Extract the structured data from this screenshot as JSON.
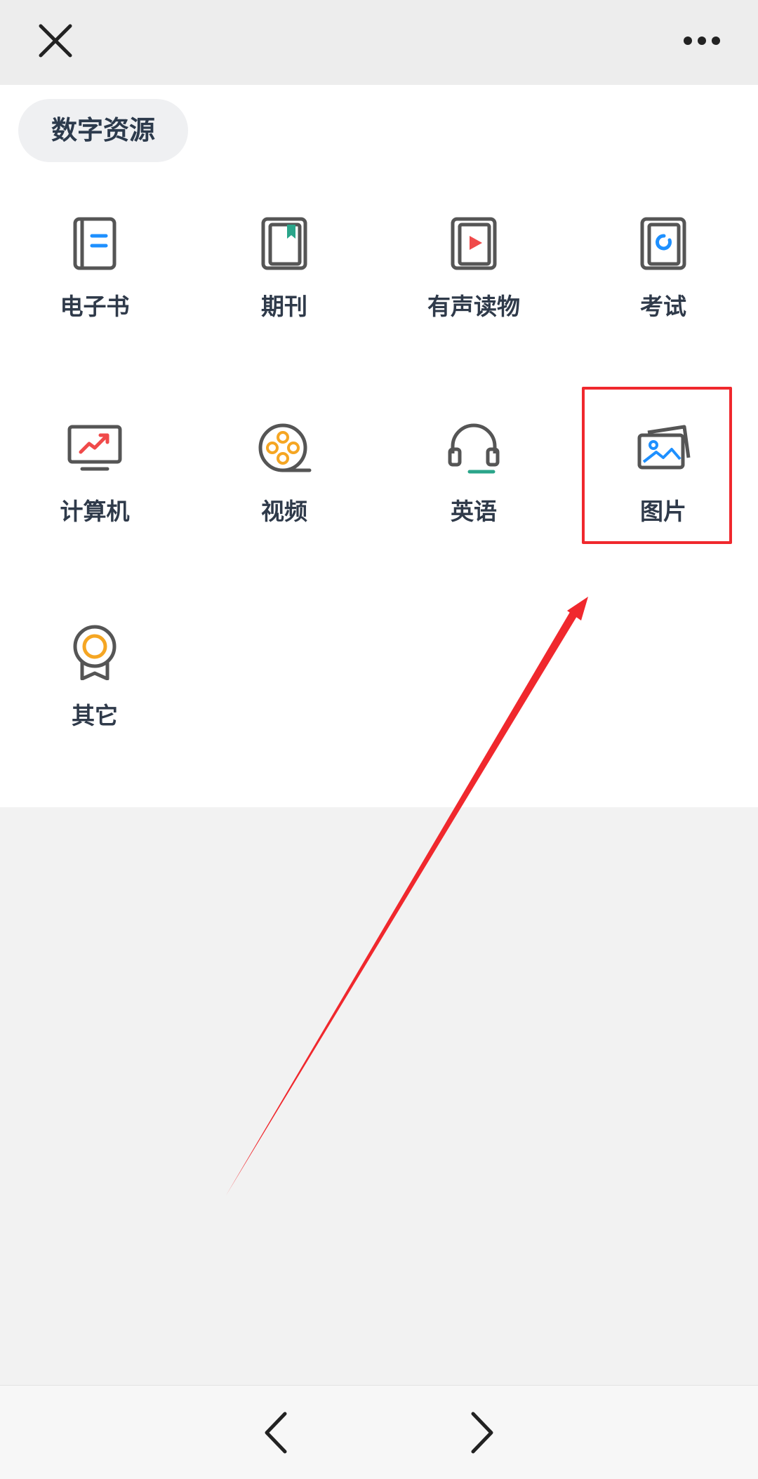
{
  "top_bar": {
    "close_icon": "close-icon",
    "more_icon": "more-icon"
  },
  "section": {
    "title": "数字资源"
  },
  "grid": [
    {
      "label": "电子书",
      "icon": "ebook-icon"
    },
    {
      "label": "期刊",
      "icon": "journal-icon"
    },
    {
      "label": "有声读物",
      "icon": "audiobook-icon"
    },
    {
      "label": "考试",
      "icon": "exam-icon"
    },
    {
      "label": "计算机",
      "icon": "computer-icon"
    },
    {
      "label": "视频",
      "icon": "video-icon"
    },
    {
      "label": "英语",
      "icon": "headphones-icon"
    },
    {
      "label": "图片",
      "icon": "picture-icon"
    },
    {
      "label": "其它",
      "icon": "medal-icon"
    }
  ],
  "annotation": {
    "highlighted_item": "图片",
    "color": "#f0282d"
  },
  "bottom_bar": {
    "back_icon": "chevron-left-icon",
    "forward_icon": "chevron-right-icon"
  },
  "colors": {
    "icon_gray": "#555555",
    "accent_blue": "#1e90ff",
    "accent_green": "#2aa58a",
    "accent_red": "#f04a4a",
    "accent_orange": "#f5a623"
  }
}
